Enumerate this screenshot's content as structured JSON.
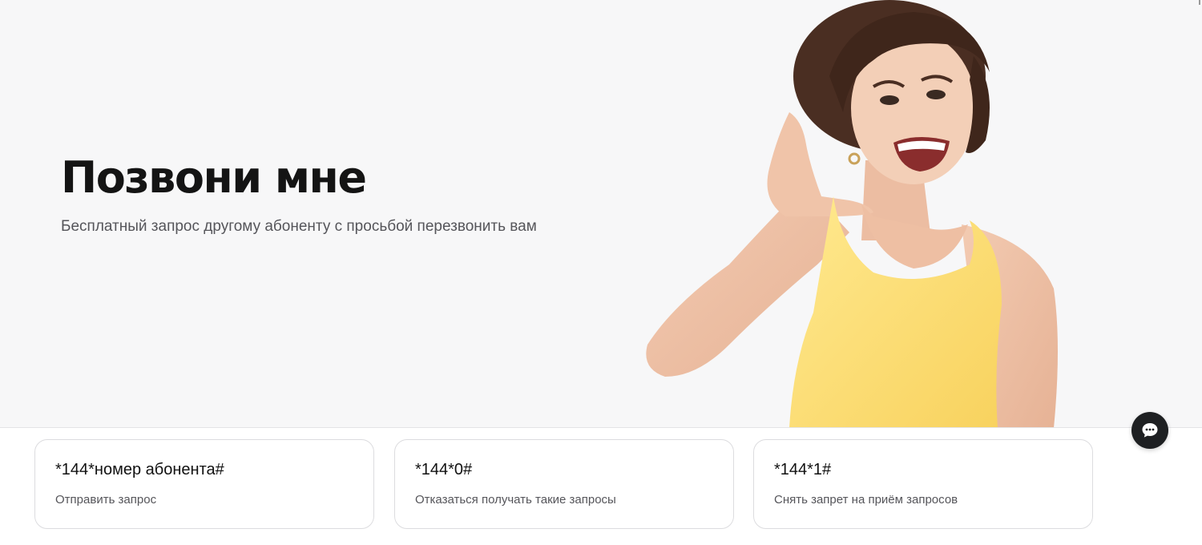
{
  "hero": {
    "title": "Позвони мне",
    "subtitle": "Бесплатный запрос другому абоненту с просьбой перезвонить вам",
    "image_icon": "woman-phone-gesture-photo"
  },
  "cards": [
    {
      "code": "*144*номер абонента#",
      "description": "Отправить запрос"
    },
    {
      "code": "*144*0#",
      "description": "Отказаться получать такие запросы"
    },
    {
      "code": "*144*1#",
      "description": "Снять запрет на приём запросов"
    }
  ],
  "chat": {
    "icon": "chat-bubble-icon"
  },
  "colors": {
    "hero_bg": "#f7f7f8",
    "title": "#141414",
    "subtitle": "#55555a",
    "card_border": "#dcdcdf",
    "chat_bg": "#1e2022",
    "top_color": "#fde27a"
  }
}
